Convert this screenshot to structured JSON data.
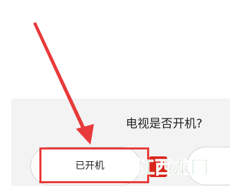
{
  "dialog": {
    "question": "电视是否开机?",
    "confirm_button_label": "已开机"
  },
  "watermark": {
    "text": "江西龙网"
  },
  "colors": {
    "highlight": "#e83a3a",
    "dialog_background": "#f3f3f3",
    "watermark_green": "#2f8f3a",
    "watermark_red": "#d9261c"
  }
}
